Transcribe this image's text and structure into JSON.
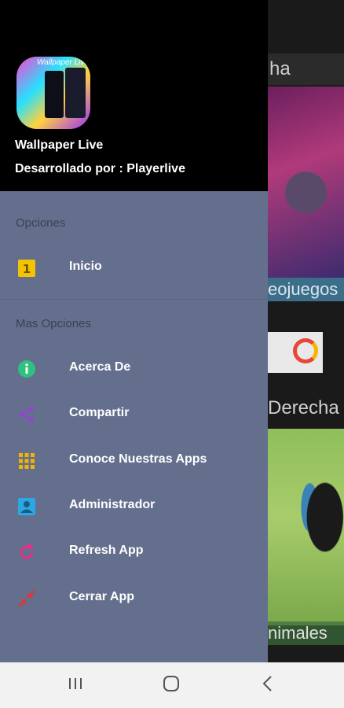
{
  "background": {
    "top_fragment": "ha",
    "caption1": "eojuegos",
    "section_fragment": "Derecha",
    "caption2": "nimales"
  },
  "drawer": {
    "logo_script": "Wallpaper Live",
    "app_title": "Wallpaper Live",
    "app_subtitle": "Desarrollado por : Playerlive",
    "section1_label": "Opciones",
    "section2_label": "Mas Opciones",
    "items": [
      {
        "label": "Inicio",
        "icon": "home-badge-icon",
        "color": "#f5c400"
      },
      {
        "label": "Acerca De",
        "icon": "info-icon",
        "color": "#2ec27e"
      },
      {
        "label": "Compartir",
        "icon": "share-icon",
        "color": "#9c3ddb"
      },
      {
        "label": "Conoce Nuestras Apps",
        "icon": "apps-grid-icon",
        "color": "#f5b400"
      },
      {
        "label": "Administrador",
        "icon": "account-box-icon",
        "color": "#2aa8e6"
      },
      {
        "label": "Refresh App",
        "icon": "refresh-icon",
        "color": "#e6308a"
      },
      {
        "label": "Cerrar App",
        "icon": "close-arrows-icon",
        "color": "#e0343a"
      }
    ]
  },
  "navbar": {
    "recent_icon": "recent-apps-icon",
    "home_icon": "home-icon",
    "back_icon": "back-icon"
  }
}
